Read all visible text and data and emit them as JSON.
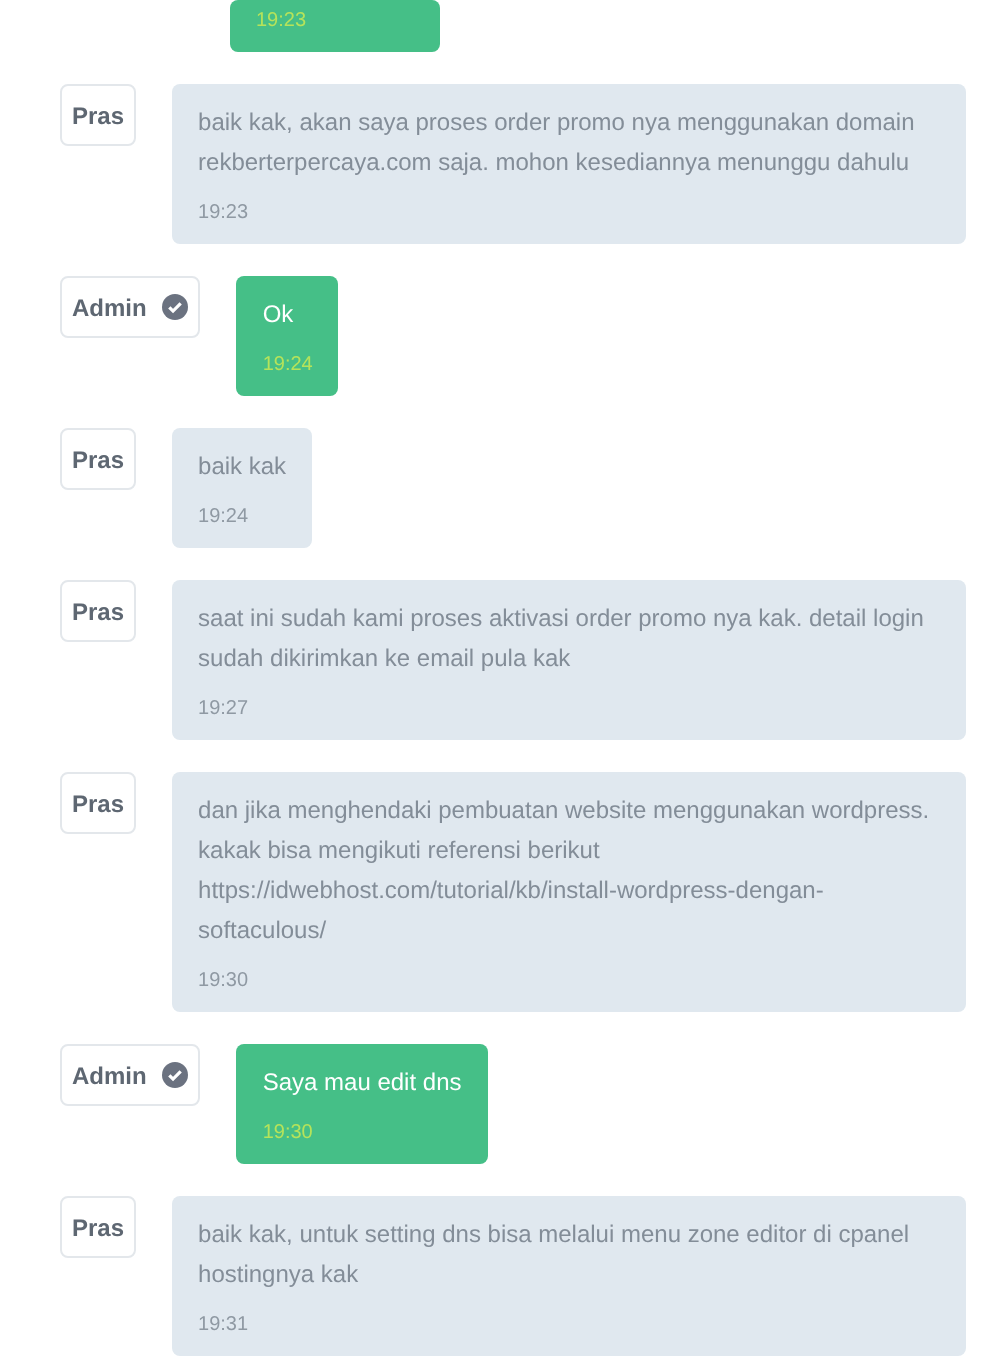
{
  "messages": [
    {
      "kind": "admin",
      "time": "19:23"
    },
    {
      "kind": "user",
      "sender": "Pras",
      "text": "baik kak, akan saya proses order promo nya menggunakan domain rekberterpercaya.com saja. mohon kesediannya menunggu dahulu",
      "time": "19:23"
    },
    {
      "kind": "admin",
      "sender": "Admin",
      "verified": true,
      "text": "Ok",
      "time": "19:24"
    },
    {
      "kind": "user",
      "sender": "Pras",
      "text": "baik kak",
      "time": "19:24"
    },
    {
      "kind": "user",
      "sender": "Pras",
      "text": "saat ini sudah kami proses aktivasi order promo nya kak. detail login sudah dikirimkan ke email pula kak",
      "time": "19:27"
    },
    {
      "kind": "user",
      "sender": "Pras",
      "text": "dan jika menghendaki pembuatan website menggunakan wordpress. kakak bisa mengikuti referensi berikut https://idwebhost.com/tutorial/kb/install-wordpress-dengan-softaculous/",
      "time": "19:30"
    },
    {
      "kind": "admin",
      "sender": "Admin",
      "verified": true,
      "text": "Saya mau edit dns",
      "time": "19:30"
    },
    {
      "kind": "user",
      "sender": "Pras",
      "text": "baik kak, untuk setting dns bisa melalui menu zone editor di cpanel hostingnya kak",
      "time": "19:31"
    }
  ]
}
